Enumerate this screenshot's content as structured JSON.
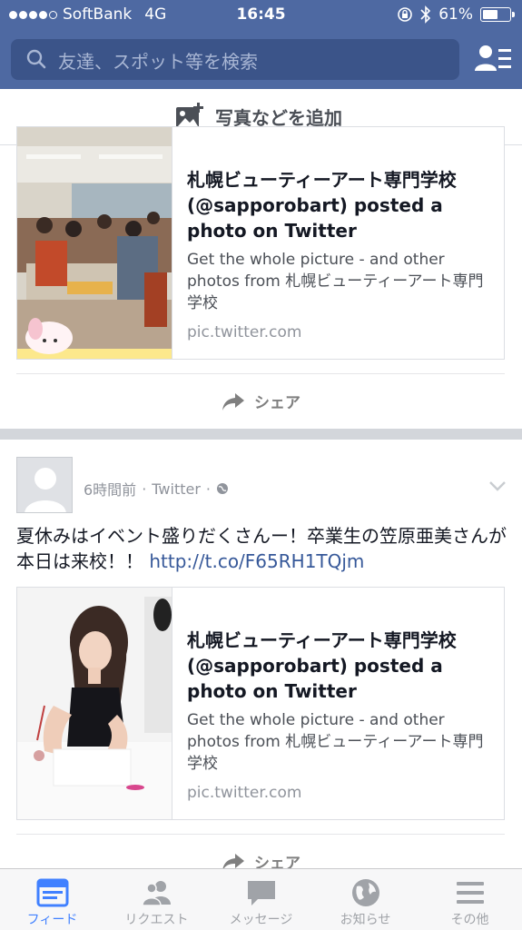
{
  "status_bar": {
    "carrier": "SoftBank",
    "network": "4G",
    "time": "16:45",
    "battery": "61%",
    "battery_level": 0.61
  },
  "header": {
    "search_placeholder": "友達、スポット等を検索"
  },
  "composer": {
    "add_photo_label": "写真などを追加"
  },
  "feed": {
    "post1": {
      "card": {
        "title": "札幌ビューティーアート専門学校 (@sapporobart) posted a photo on Twitter",
        "description": "Get the whole picture - and other photos from 札幌ビューティーアート専門学校",
        "domain": "pic.twitter.com"
      },
      "share_label": "シェア"
    },
    "post2": {
      "time_ago": "6時間前",
      "source": "Twitter",
      "text": "夏休みはイベント盛りだくさんー！卒業生の笠原亜美さんが本日は来校！！ ",
      "link": "http://t.co/F65RH1TQjm",
      "card": {
        "title": "札幌ビューティーアート専門学校 (@sapporobart) posted a photo on Twitter",
        "description": "Get the whole picture - and other photos from 札幌ビューティーアート専門学校",
        "domain": "pic.twitter.com"
      },
      "share_label": "シェア"
    }
  },
  "tabbar": {
    "items": [
      {
        "label": "フィード",
        "icon": "feed-icon",
        "active": true
      },
      {
        "label": "リクエスト",
        "icon": "friends-icon",
        "active": false
      },
      {
        "label": "メッセージ",
        "icon": "messages-icon",
        "active": false
      },
      {
        "label": "お知らせ",
        "icon": "globe-icon",
        "active": false
      },
      {
        "label": "その他",
        "icon": "menu-icon",
        "active": false
      }
    ]
  },
  "colors": {
    "brand": "#4e69a2",
    "link": "#365899",
    "tab_active": "#4080ff"
  }
}
